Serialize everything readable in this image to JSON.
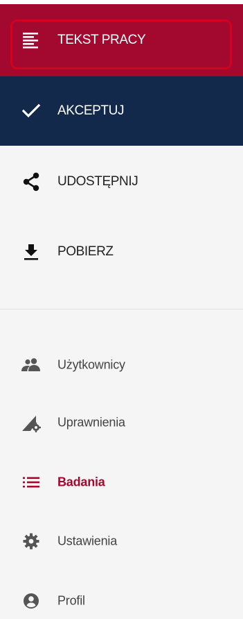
{
  "actions": {
    "text": {
      "label": "TEKST PRACY",
      "icon": "text-lines-icon"
    },
    "accept": {
      "label": "AKCEPTUJ",
      "icon": "check-icon"
    },
    "share": {
      "label": "UDOSTĘPNIJ",
      "icon": "share-icon"
    },
    "download": {
      "label": "POBIERZ",
      "icon": "download-icon"
    }
  },
  "nav": {
    "users": {
      "label": "Użytkownicy",
      "icon": "people-icon"
    },
    "permissions": {
      "label": "Uprawnienia",
      "icon": "signal-gear-icon"
    },
    "studies": {
      "label": "Badania",
      "icon": "list-icon",
      "active": true
    },
    "settings": {
      "label": "Ustawienia",
      "icon": "gear-icon"
    },
    "profile": {
      "label": "Profil",
      "icon": "account-circle-icon"
    }
  },
  "colors": {
    "primary": "#a3082e",
    "navy": "#13294b",
    "focus": "#d4001e",
    "muted": "#444444"
  }
}
